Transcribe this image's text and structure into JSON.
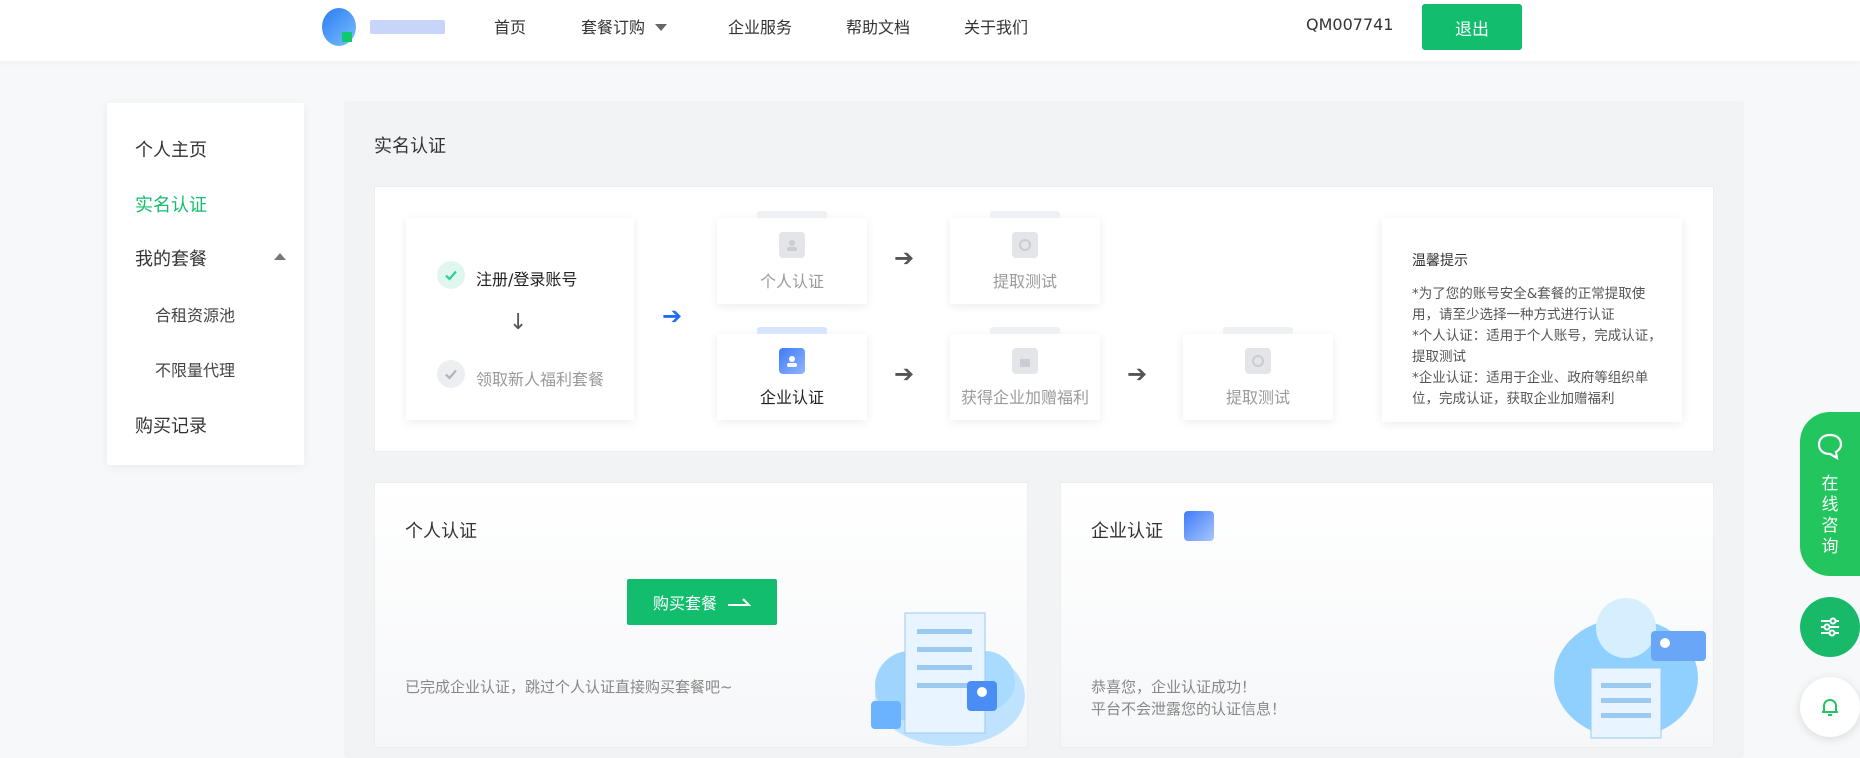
{
  "header": {
    "nav": [
      {
        "label": "首页"
      },
      {
        "label": "套餐订购"
      },
      {
        "label": "企业服务"
      },
      {
        "label": "帮助文档"
      },
      {
        "label": "关于我们"
      }
    ],
    "account_id": "QM007741",
    "logout_label": "退出",
    "brand_color": "#12bd6e"
  },
  "sidebar": {
    "items": [
      {
        "label": "个人主页"
      },
      {
        "label": "实名认证",
        "active": true
      },
      {
        "label": "我的套餐"
      },
      {
        "label": "合租资源池"
      },
      {
        "label": "不限量代理"
      },
      {
        "label": "购买记录"
      }
    ]
  },
  "main": {
    "title": "实名认证",
    "flow": {
      "step1": "注册/登录账号",
      "step2": "领取新人福利套餐",
      "personal_cert": "个人认证",
      "extract_test_1": "提取测试",
      "enterprise_cert": "企业认证",
      "enterprise_bonus": "获得企业加赠福利",
      "extract_test_2": "提取测试"
    },
    "tips": {
      "title": "温馨提示",
      "lines": [
        "*为了您的账号安全&套餐的正常提取使用，请至少选择一种方式进行认证",
        "*个人认证：适用于个人账号，完成认证，提取测试",
        "*企业认证：适用于企业、政府等组织单位，完成认证，获取企业加赠福利"
      ]
    },
    "personal_card": {
      "title": "个人认证",
      "button": "购买套餐",
      "note": "已完成企业认证，跳过个人认证直接购买套餐吧~"
    },
    "enterprise_card": {
      "title": "企业认证",
      "note_line1": "恭喜您，企业认证成功！",
      "note_line2": "平台不会泄露您的认证信息！"
    }
  },
  "float": {
    "chat_chars": [
      "在",
      "线",
      "咨",
      "询"
    ]
  }
}
